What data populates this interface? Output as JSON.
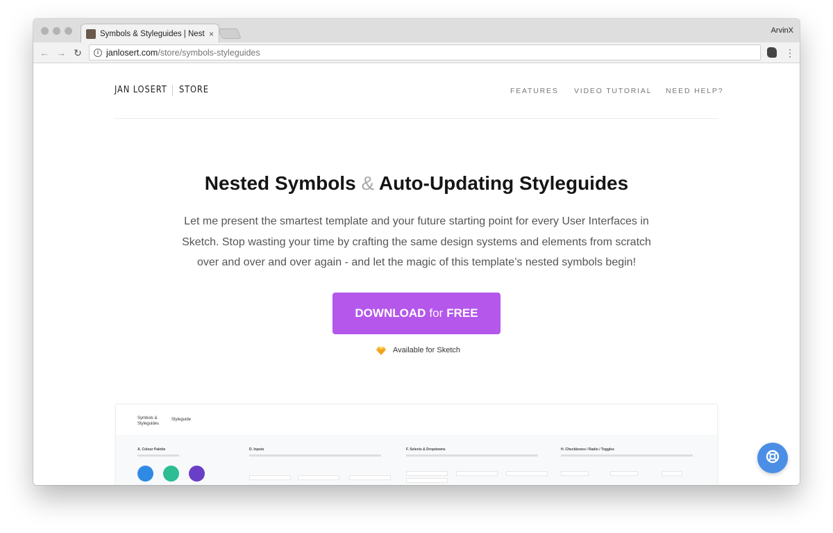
{
  "browser": {
    "tab_title": "Symbols & Styleguides | Neste",
    "tab_close": "×",
    "profile_name": "ArvinX",
    "url_host": "janlosert.com",
    "url_path": "/store/symbols-styleguides",
    "back_glyph": "←",
    "forward_glyph": "→",
    "reload_glyph": "↻",
    "menu_glyph": "⋮"
  },
  "site": {
    "brand": "JAN LOSERT",
    "section": "STORE",
    "nav": [
      {
        "label": "FEATURES"
      },
      {
        "label": "VIDEO TUTORIAL"
      },
      {
        "label": "NEED HELP?"
      }
    ]
  },
  "hero": {
    "title_part1": "Nested Symbols",
    "title_amp": "&",
    "title_part2": "Auto-Updating Styleguides",
    "description": "Let me present the smartest template and your future starting point for every User Interfaces in Sketch. Stop wasting your time by crafting the same design systems and elements from scratch over and over and over again - and let the magic of this template’s nested symbols begin!",
    "cta_strong1": "DOWNLOAD",
    "cta_normal": "for",
    "cta_strong2": "FREE",
    "availability": "Available for Sketch"
  },
  "preview": {
    "logo": "Symbols & Styleguides",
    "nav_item": "Styleguide",
    "sections": [
      {
        "title": "A. Colour Palette"
      },
      {
        "title": "D. Inputs"
      },
      {
        "title": "F. Selects & Dropdowns"
      },
      {
        "title": "H. Checkboxes / Radio / Toggles"
      }
    ]
  },
  "colors": {
    "accent": "#b457ea",
    "help_button": "#4a8ee5",
    "palette": [
      "#2f8ae6",
      "#2cbd92",
      "#6a3fc7"
    ]
  },
  "icons": {
    "sketch": "sketch-diamond-icon",
    "help": "lifebuoy-icon",
    "info": "info-icon"
  }
}
